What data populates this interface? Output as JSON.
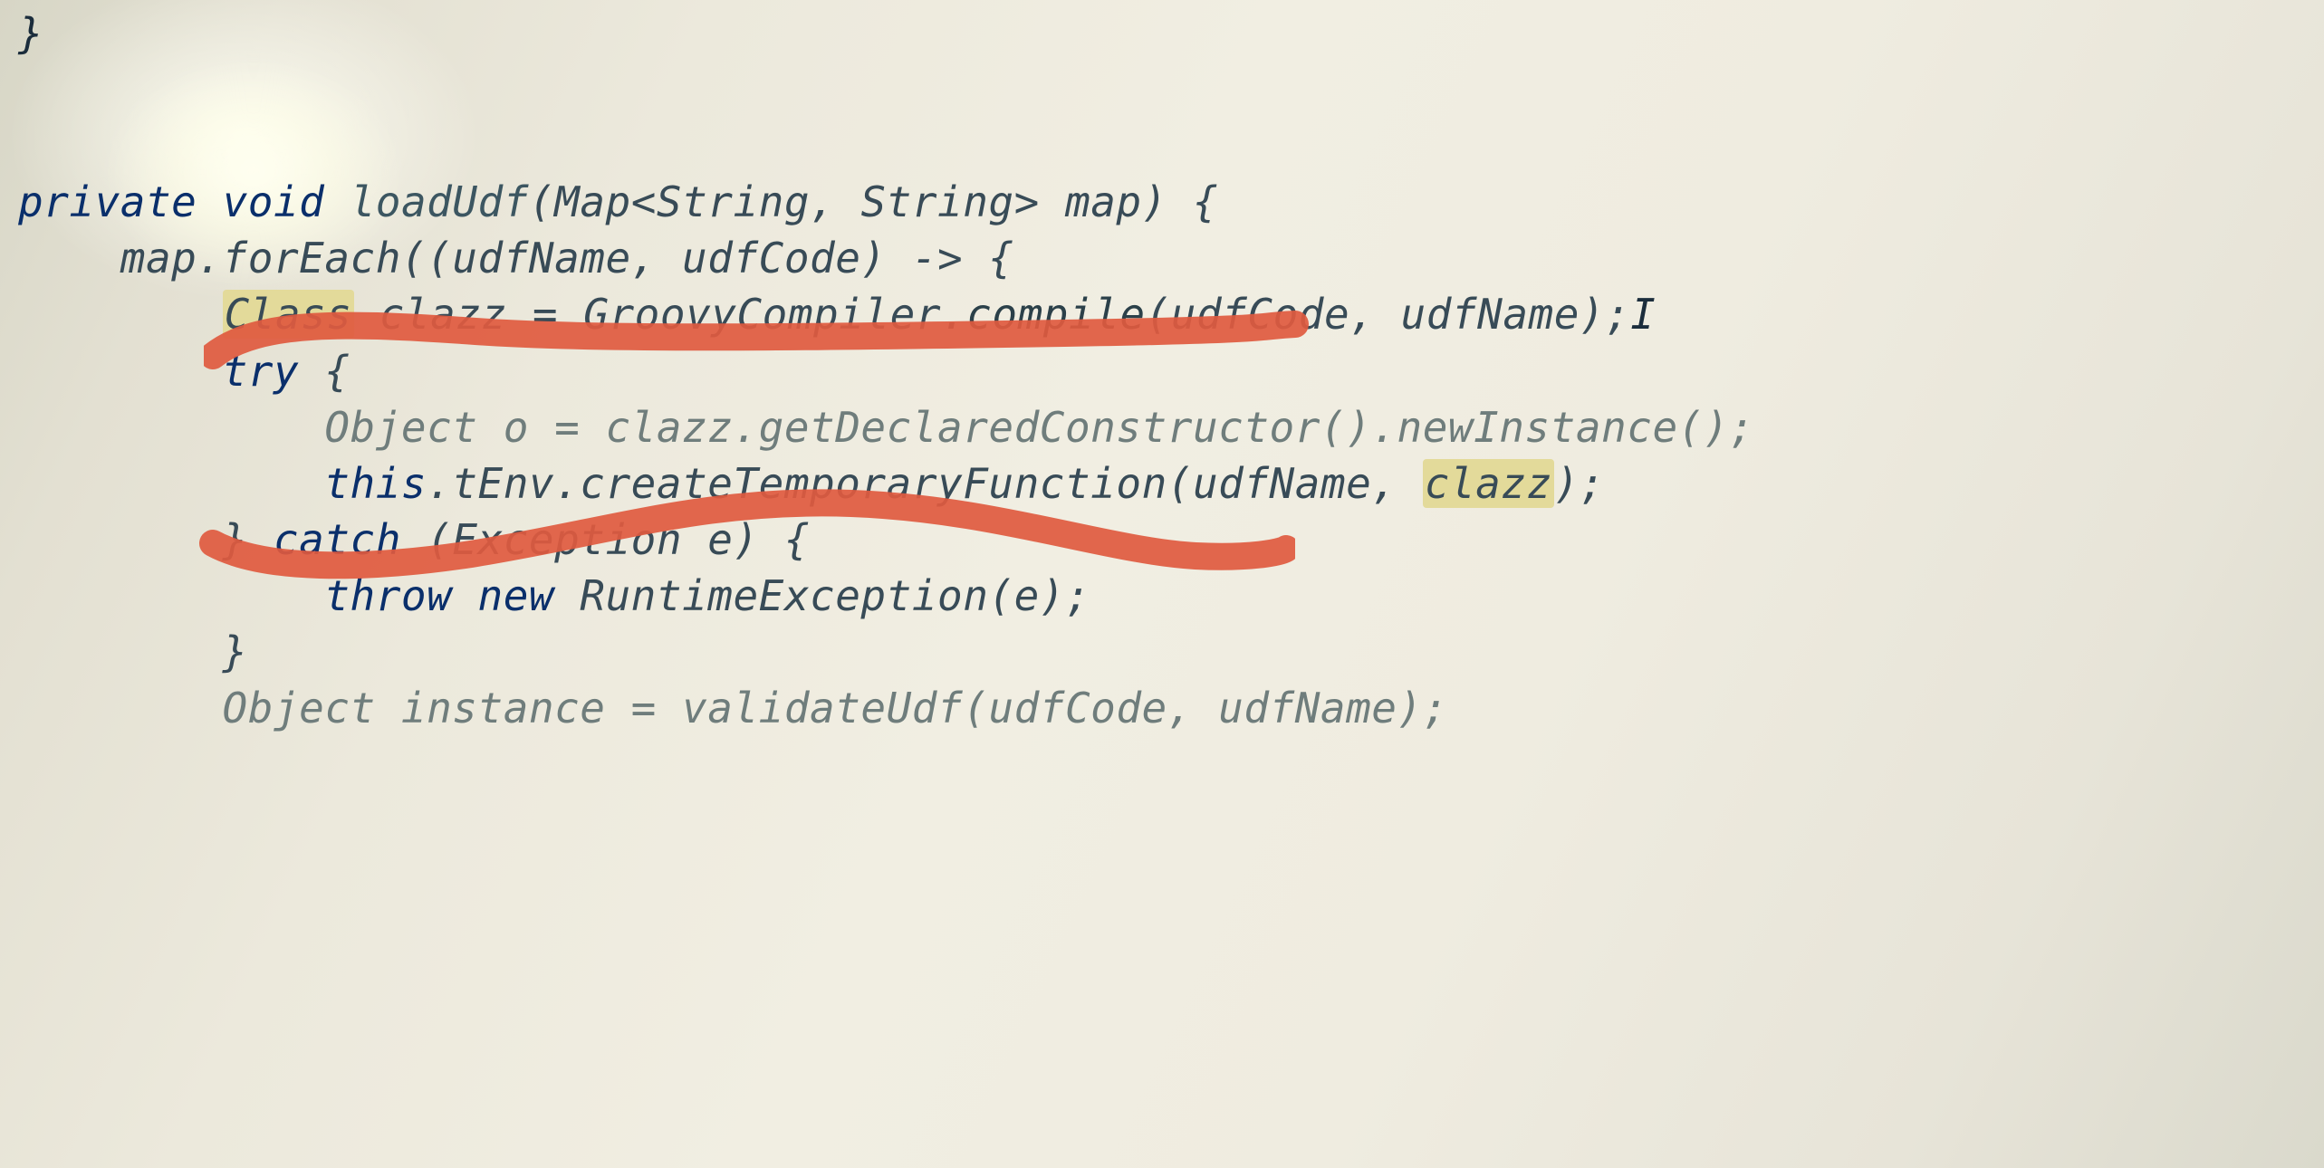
{
  "code": {
    "l1": "}",
    "l2": "",
    "l3": "",
    "l4_kw1": "private",
    "l4_ty": "void",
    "l4_m": "loadUdf",
    "l4_p1": "(Map<String, String> map) {",
    "l5_a": "    map.forEach((udfName, udfCode) -> {",
    "l6_a": "        ",
    "l6_cls": "Class",
    "l6_b": " clazz = GroovyCompiler.",
    "l6_c": "compile",
    "l6_d": "(udfCode, udfName);",
    "l7_a": "        ",
    "l7_try": "try",
    "l7_b": " {",
    "l8": "            Object o = clazz.getDeclaredConstructor().newInstance();",
    "l9_a": "            ",
    "l9_this": "this",
    "l9_b": ".tEnv.createTemporaryFunction(udfName, ",
    "l9_clz": "clazz",
    "l9_c": ");",
    "l10_a": "        } ",
    "l10_catch": "catch",
    "l10_b": " (Exception e) {",
    "l11_a": "            ",
    "l11_throw": "throw new",
    "l11_b": " RuntimeException(e);",
    "l12": "        }",
    "l13": "        Object instance = validateUdf(udfCode, udfName);"
  }
}
